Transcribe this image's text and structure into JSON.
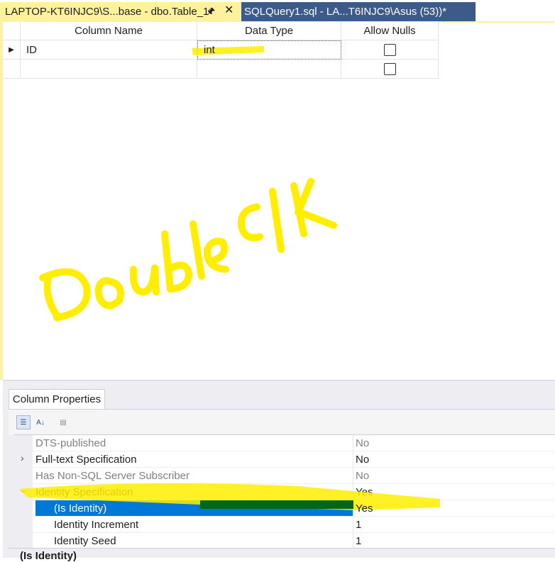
{
  "tabs": [
    {
      "label": "LAPTOP-KT6INJC9\\S...base - dbo.Table_1*",
      "active": true
    },
    {
      "label": "SQLQuery1.sql - LA...T6INJC9\\Asus (53))*",
      "active": false
    }
  ],
  "icons": {
    "pin": "pin-icon",
    "close": "close-icon"
  },
  "grid": {
    "headers": [
      "Column Name",
      "Data Type",
      "Allow Nulls"
    ],
    "rows": [
      {
        "column_name": "ID",
        "data_type": "int",
        "allow_nulls": false,
        "current": true
      },
      {
        "column_name": "",
        "data_type": "",
        "allow_nulls": false,
        "current": false
      }
    ]
  },
  "annotation_text": "Double clk",
  "properties": {
    "tab_label": "Column Properties",
    "toolbar": [
      "categorized-sort-button",
      "alphabetical-sort-button",
      "property-pages-button"
    ],
    "rows": [
      {
        "name": "DTS-published",
        "value": "No",
        "disabled": true
      },
      {
        "name": "Full-text Specification",
        "value": "No",
        "expand": "collapsed"
      },
      {
        "name": "Has Non-SQL Server Subscriber",
        "value": "No",
        "disabled": true
      },
      {
        "name": "Identity Specification",
        "value": "Yes",
        "expand": "expanded"
      },
      {
        "name": "(Is Identity)",
        "value": "Yes",
        "selected": true,
        "child": true
      },
      {
        "name": "Identity Increment",
        "value": "1",
        "child": true
      },
      {
        "name": "Identity Seed",
        "value": "1",
        "child": true
      }
    ],
    "description_title": "(Is Identity)"
  },
  "colors": {
    "active_tab": "#fff29d",
    "inactive_tab": "#3c5a8a",
    "highlighter": "#ffee00",
    "selection": "#0078d7"
  }
}
